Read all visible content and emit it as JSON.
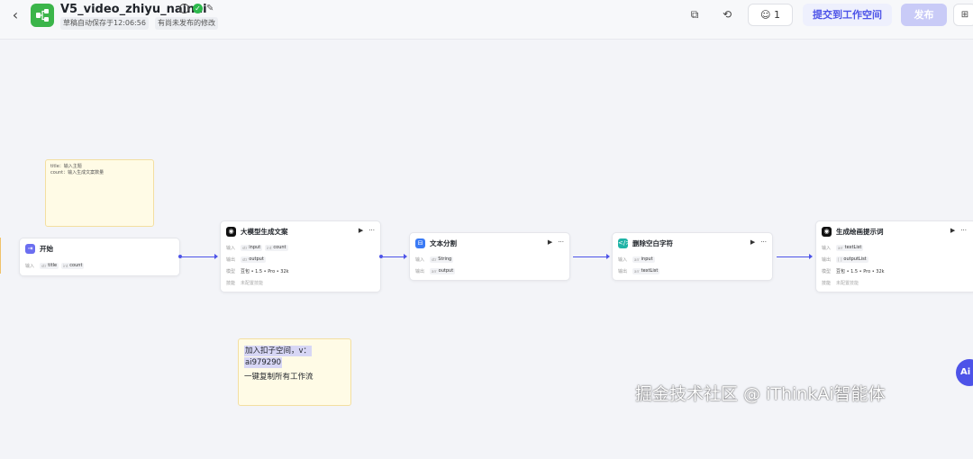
{
  "header": {
    "back_icon": "chevron-left-icon",
    "app_icon": "workflow-icon",
    "brand_color": "#3bb54a",
    "title": "V5_video_zhiyu_nainai",
    "status_saved": "草稿自动保存于12:06:56",
    "status_unpublished": "有尚未发布的修改",
    "members_count": "1",
    "submit_label": "提交到工作空间",
    "publish_label": "发布",
    "accent_color": "#4d53e8"
  },
  "canvas": {
    "note_top": {
      "text": "title：输入主题\ncount：输入生成文案数量"
    },
    "start_node": {
      "title": "开始",
      "input_label": "输入",
      "params": [
        {
          "type": "str",
          "name": "title"
        },
        {
          "type": "int",
          "name": "count"
        }
      ]
    },
    "llm_node": {
      "title": "大模型生成文案",
      "input_label": "输入",
      "inputs": [
        {
          "type": "str",
          "name": "input"
        },
        {
          "type": "int",
          "name": "count"
        }
      ],
      "output_label": "输出",
      "output": {
        "type": "str",
        "name": "output"
      },
      "model_label": "模型",
      "model": "豆包 • 1.5 • Pro • 32k",
      "skill_label": "技能",
      "skill": "未配置技能"
    },
    "split_node": {
      "title": "文本分割",
      "input_label": "输入",
      "input": {
        "type": "str",
        "name": "String"
      },
      "output_label": "输出",
      "output": {
        "type": "arr",
        "name": "output"
      }
    },
    "trim_node": {
      "title": "删除空白字符",
      "input_label": "输入",
      "input": {
        "type": "arr",
        "name": "input"
      },
      "output_label": "输出",
      "output": {
        "type": "arr",
        "name": "textList"
      }
    },
    "prompt_node": {
      "title": "生成绘画提示词",
      "input_label": "输入",
      "input": {
        "type": "arr",
        "name": "textList"
      },
      "output_label": "输出",
      "output": {
        "type": "[ ]",
        "name": "outputList"
      },
      "model_label": "模型",
      "model": "豆包 • 1.5 • Pro • 32k",
      "skill_label": "技能",
      "skill": "未配置技能"
    },
    "promo_note": {
      "line1": "加入扣子空间，v：",
      "line2": "ai979290",
      "line3": "一键复制所有工作流"
    }
  },
  "ai_badge": "Ai",
  "watermark": "掘金技术社区 @ iThinkAi智能体"
}
